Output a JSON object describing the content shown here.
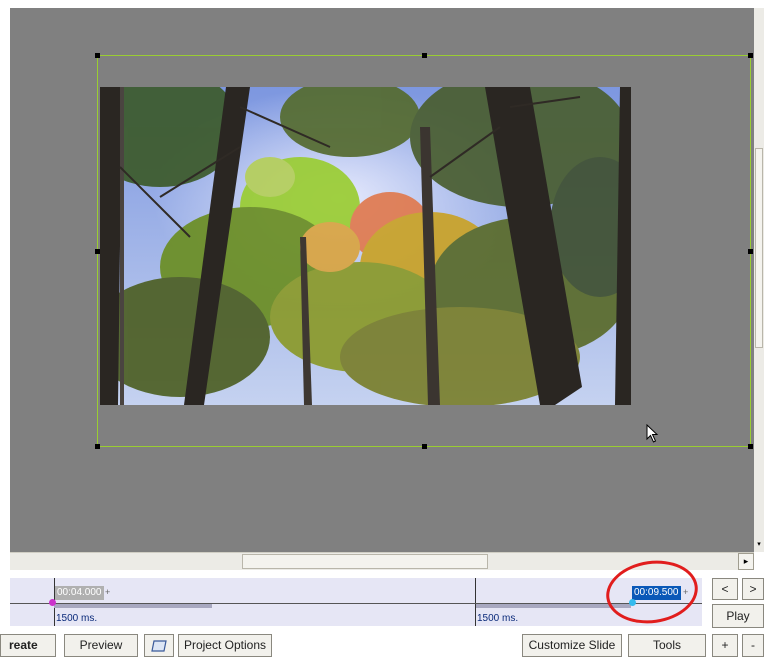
{
  "timeline": {
    "slide1_time": "00:04.000",
    "slide1_plus": "+",
    "slide1_duration": "1500 ms.",
    "slide2_duration": "1500 ms.",
    "slide2_time": "00:09.500",
    "slide2_plus": "+"
  },
  "nav": {
    "prev_label": "<",
    "next_label": ">",
    "play_label": "Play",
    "zoom_in_label": "+",
    "zoom_out_label": "-"
  },
  "bottom_bar": {
    "create_label": "reate",
    "preview_label": "Preview",
    "project_options_label": "Project Options",
    "customize_slide_label": "Customize Slide",
    "tools_label": "Tools"
  },
  "icons": {
    "scroll_right": "▸",
    "scroll_down": "▾"
  },
  "colors": {
    "canvas_bg": "#808080",
    "selection_frame": "#9acd32",
    "timeline_bg": "#e6e6f5",
    "selected_time_bg": "#0a58b8",
    "annotation_circle": "#e11d1d"
  }
}
